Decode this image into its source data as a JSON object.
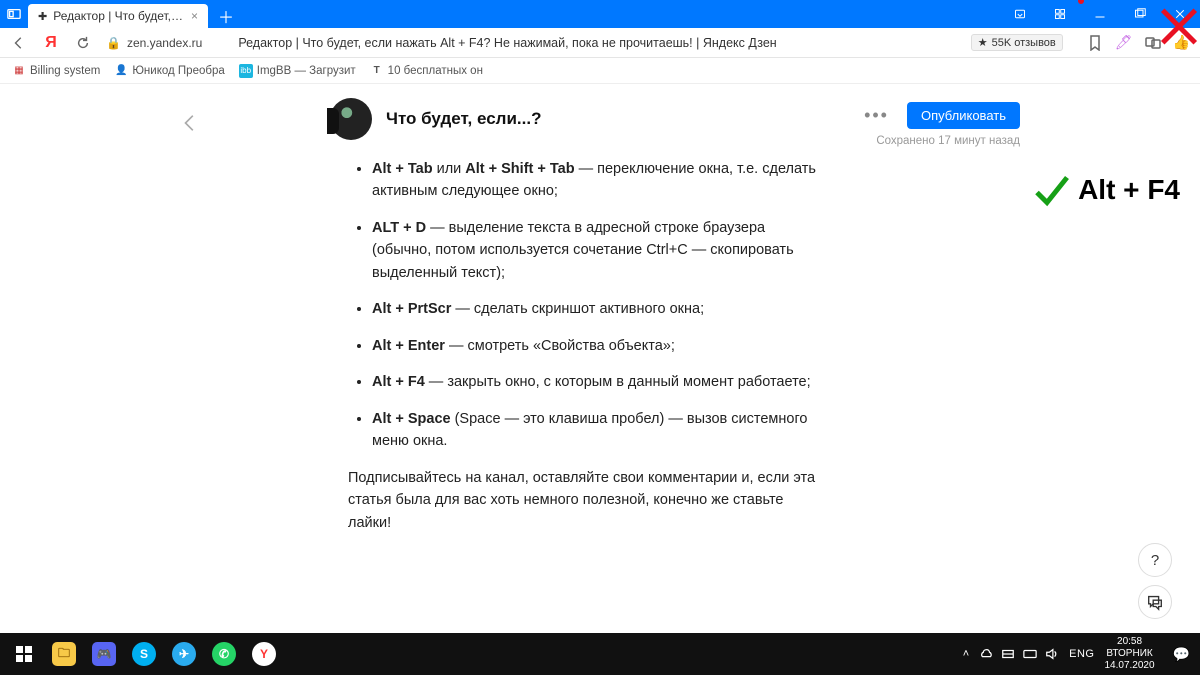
{
  "browser": {
    "tab_title": "Редактор | Что будет, ес",
    "url_host": "zen.yandex.ru",
    "page_title": "Редактор | Что будет, если нажать Alt + F4? Не нажимай, пока не прочитаешь! | Яндекс Дзен",
    "reviews": "55K отзывов",
    "bookmarks": [
      "Billing system",
      "Юникод Преобра",
      "ImgBB — Загрузит",
      "10 бесплатных он"
    ]
  },
  "editor": {
    "channel_title": "Что будет, если...?",
    "publish_label": "Опубликовать",
    "saved_status": "Сохранено 17 минут назад",
    "help_label": "?",
    "list_items": [
      {
        "bold_a": "Alt + Tab",
        "mid": " или ",
        "bold_b": "Alt + Shift + Tab",
        "text": " — переключение окна, т.е. сделать активным следующее окно;"
      },
      {
        "bold_a": "ALT + D",
        "text": " — выделение текста в адресной строке браузера (обычно, потом используется сочетание Ctrl+C — скопировать выделенный текст);"
      },
      {
        "bold_a": "Alt + PrtScr",
        "text": " — сделать скриншот активного окна;"
      },
      {
        "bold_a": "Alt + Enter",
        "text": " — смотреть «Свойства объекта»;"
      },
      {
        "bold_a": "Alt + F4",
        "text": " — закрыть окно, с которым в данный момент работаете;"
      },
      {
        "bold_a": "Alt + Space",
        "text": " (Space — это клавиша пробел) — вызов системного меню окна."
      }
    ],
    "closing": "Подписывайтесь на канал, оставляйте свои комментарии и, если эта статья была для вас хоть немного полезной, конечно же ставьте лайки!",
    "overlay_text": "Alt + F4"
  },
  "taskbar": {
    "lang": "ENG",
    "time": "20:58",
    "day": "ВТОРНИК",
    "date": "14.07.2020"
  }
}
